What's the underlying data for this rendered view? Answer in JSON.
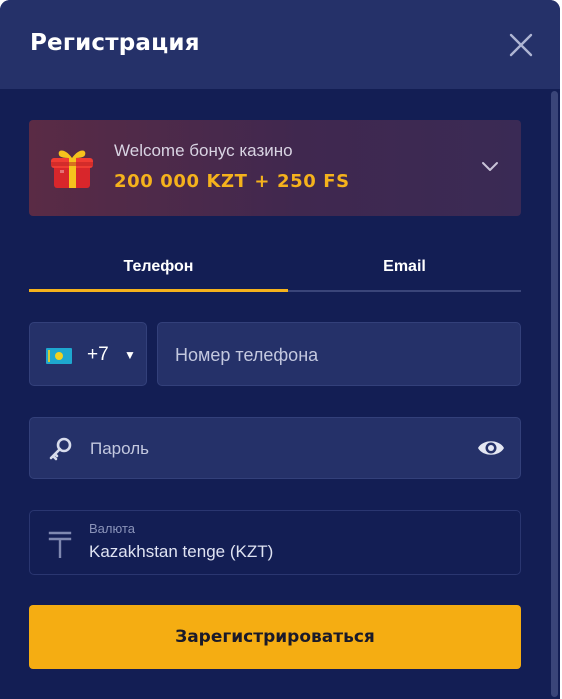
{
  "header": {
    "title": "Регистрация",
    "close_icon": "close-icon"
  },
  "bonus": {
    "subtitle": "Welcome бонус казино",
    "amount": "200 000 KZT + 250 FS",
    "icon": "gift-icon",
    "expand_icon": "chevron-down-icon",
    "amount_color": "#f5b21c"
  },
  "tabs": [
    {
      "label": "Телефон",
      "active": true
    },
    {
      "label": "Email",
      "active": false
    }
  ],
  "phone": {
    "country_flag": "kazakhstan-flag",
    "country_code": "+7",
    "caret": "▼",
    "placeholder": "Номер телефона",
    "value": ""
  },
  "password": {
    "placeholder": "Пароль",
    "value": "",
    "icon": "key-icon",
    "toggle_icon": "eye-icon"
  },
  "currency": {
    "label": "Валюта",
    "value": "Kazakhstan tenge (KZT)",
    "icon": "tenge-icon"
  },
  "submit_label": "Зарегистрироваться",
  "colors": {
    "background": "#131e54",
    "header": "#253169",
    "accent": "#f5ad12"
  }
}
